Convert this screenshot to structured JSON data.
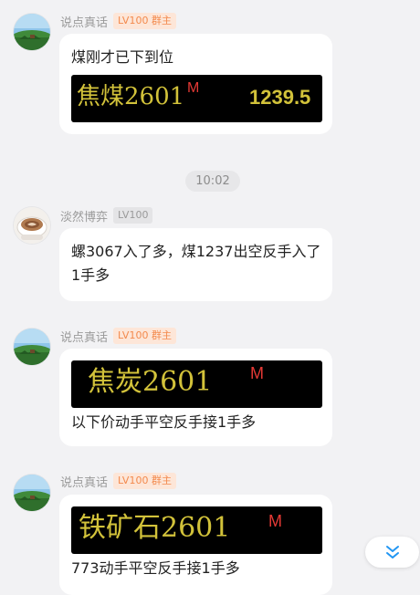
{
  "messages": [
    {
      "name": "说点真话",
      "badge": "LV100 群主",
      "text": "煤刚才已下到位",
      "quote": {
        "name": "焦煤2601",
        "mark": "M",
        "price": "1239.5"
      }
    },
    {
      "name": "淡然博弈",
      "badge": "LV100",
      "text": "螺3067入了多，煤1237出空反手入了1手多"
    },
    {
      "name": "说点真话",
      "badge": "LV100 群主",
      "text": "以下价动手平空反手接1手多",
      "quote": {
        "name": "焦炭2601",
        "mark": "M"
      }
    },
    {
      "name": "说点真话",
      "badge": "LV100 群主",
      "text": "773动手平空反手接1手多",
      "quote": {
        "name": "铁矿石2601",
        "mark": "M"
      }
    }
  ],
  "timestamp": "10:02",
  "icons": {
    "scroll_to_bottom": "double-chevron-down-icon",
    "avatar_landscape": "landscape-avatar",
    "avatar_coffee": "coffee-cup-avatar"
  },
  "colors": {
    "host_badge_bg": "#fde6d8",
    "host_badge_text": "#f38a4d",
    "quote_text": "#d2c23a",
    "quote_mark": "#e53935",
    "scroll_icon": "#2196f3"
  }
}
